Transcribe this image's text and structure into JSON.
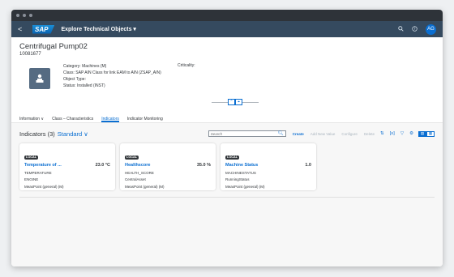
{
  "shell": {
    "back": "<",
    "logo": "SAP",
    "app_title": "Explore Technical Objects ▾",
    "search_icon": "search-icon",
    "help_icon": "help-icon",
    "avatar": "AG"
  },
  "object": {
    "title": "Centrifugal Pump02",
    "id": "10081677",
    "attributes": [
      "Category: Machines (M)",
      "Class: SAP AIN Class for link EAM to AIN (ZSAP_AIN)",
      "Object Type:",
      "Status: Installed (INST)"
    ],
    "criticality": "Criticality:"
  },
  "tabs": [
    {
      "label": "Information ∨",
      "active": false
    },
    {
      "label": "Class – Characteristics",
      "active": false
    },
    {
      "label": "Indicators",
      "active": true
    },
    {
      "label": "Indicator Monitoring",
      "active": false
    }
  ],
  "indicators": {
    "title": "Indicators (3)",
    "variant": "Standard ∨",
    "search_placeholder": "Search",
    "actions": {
      "create": "Create",
      "add_new_value": "Add New Value",
      "configure": "Configure",
      "delete": "Delete"
    },
    "cards": [
      {
        "badge": "LOCAL",
        "name": "Temperature of ...",
        "value": "23.0 °C",
        "line1": "TEMPERATURE",
        "line2": "ENGINE",
        "line3": "MeasPoint (general) (M)"
      },
      {
        "badge": "LOCAL",
        "name": "Healthscore",
        "value": "35.0 %",
        "line1": "HEALTH_SCORE",
        "line2": "CentralAsset",
        "line3": "MeasPoint (general) (M)"
      },
      {
        "badge": "LOCAL",
        "name": "Machine Status",
        "value": "1.0",
        "line1": "MACHINESTATUS",
        "line2": "RunningStatus",
        "line3": "MeasPoint (general) (M)"
      }
    ]
  }
}
